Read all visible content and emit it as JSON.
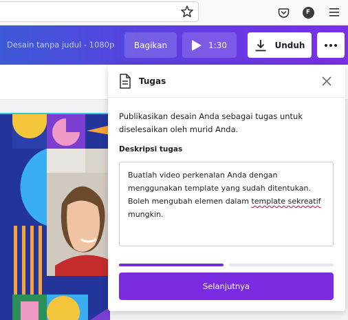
{
  "browser": {
    "icons": [
      "star-icon",
      "pocket-icon",
      "profile-icon",
      "menu-icon"
    ],
    "profile_initial": "F"
  },
  "header": {
    "doc_title": "Desain tanpa judul - 1080p",
    "share_label": "Bagikan",
    "play_duration": "1:30",
    "download_label": "Unduh"
  },
  "panel": {
    "title": "Tugas",
    "description": "Publikasikan desain Anda sebagai tugas untuk diselesaikan oleh murid Anda.",
    "field_label": "Deskripsi tugas",
    "textarea": {
      "line1": "Buatlah video perkenalan Anda dengan",
      "line2": "menggunakan template yang sudah ditentukan.",
      "line3_before": "Boleh mengubah elemen dalam ",
      "line3_misspelled": "template sekreatif",
      "line4": "mungkin."
    },
    "progress": {
      "steps": 2,
      "current": 1
    },
    "next_label": "Selanjutnya"
  },
  "colors": {
    "accent": "#7a2be0",
    "header_start": "#3d5ad8",
    "header_end": "#7a2fe8",
    "progress_done": "#7a2be0",
    "progress_todo": "#e6e6ee"
  }
}
